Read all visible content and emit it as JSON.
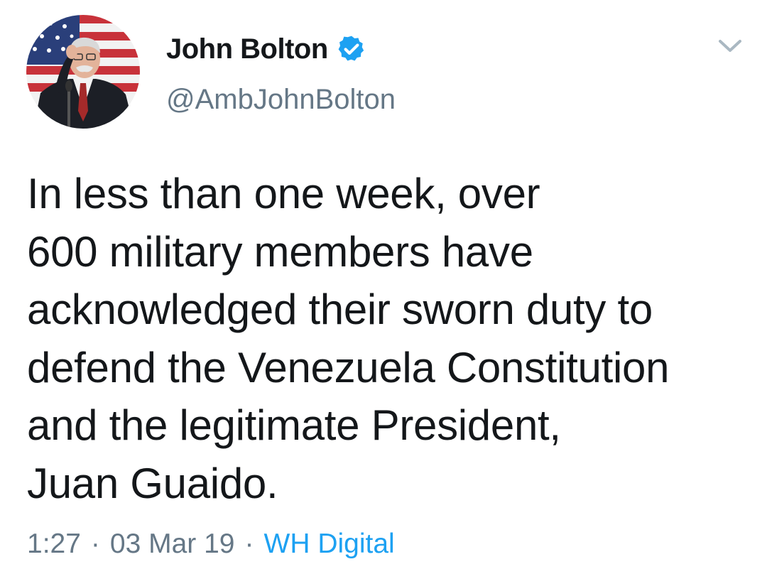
{
  "tweet": {
    "author": {
      "display_name": "John Bolton",
      "handle": "@AmbJohnBolton",
      "verified": true,
      "avatar_icon": "profile-photo"
    },
    "menu_icon": "chevron-down-icon",
    "text": "In less than one week, over\n600 military members have\nacknowledged their sworn duty to\ndefend the Venezuela Constitution\nand the legitimate President,\nJuan Guaido.",
    "time": "1:27",
    "date": "03 Mar 19",
    "separator": "·",
    "source": "WH Digital"
  },
  "colors": {
    "text": "#14171a",
    "secondary": "#657786",
    "link": "#1da1f2",
    "verified": "#1da1f2"
  }
}
